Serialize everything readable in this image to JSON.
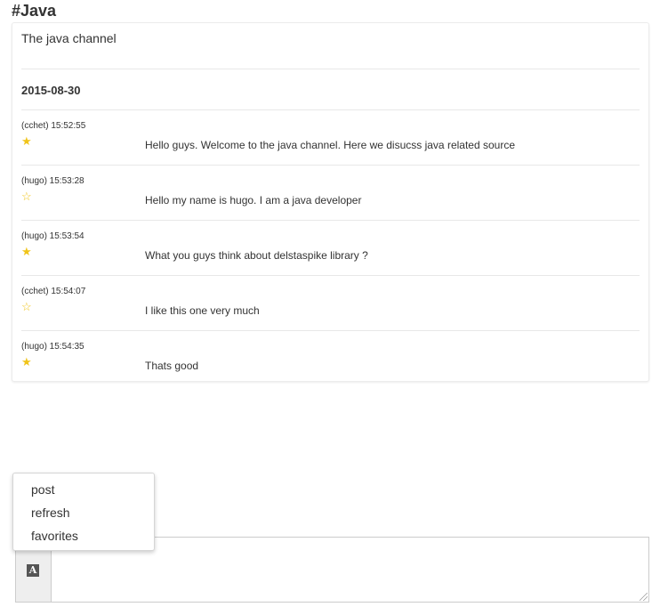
{
  "channel": {
    "title": "#Java",
    "description": "The java channel"
  },
  "date_header": "2015-08-30",
  "star_colors": {
    "filled": "#f0c419",
    "outline": "#f0c419"
  },
  "messages": [
    {
      "meta": "(cchet) 15:52:55",
      "star": "★",
      "text": "Hello guys. Welcome to the java channel. Here we disucss java related source"
    },
    {
      "meta": "(hugo) 15:53:28",
      "star": "☆",
      "text": "Hello my name is hugo. I am a java developer"
    },
    {
      "meta": "(hugo) 15:53:54",
      "star": "★",
      "text": "What you guys think about delstaspike library ?"
    },
    {
      "meta": "(cchet) 15:54:07",
      "star": "☆",
      "text": "I like this one very much"
    },
    {
      "meta": "(hugo) 15:54:35",
      "star": "★",
      "text": "Thats good"
    }
  ],
  "context_menu": {
    "items": [
      {
        "label": "post"
      },
      {
        "label": "refresh"
      },
      {
        "label": "favorites"
      }
    ]
  },
  "editor": {
    "icon": "font-icon",
    "icon_glyph": "A",
    "value": ""
  }
}
